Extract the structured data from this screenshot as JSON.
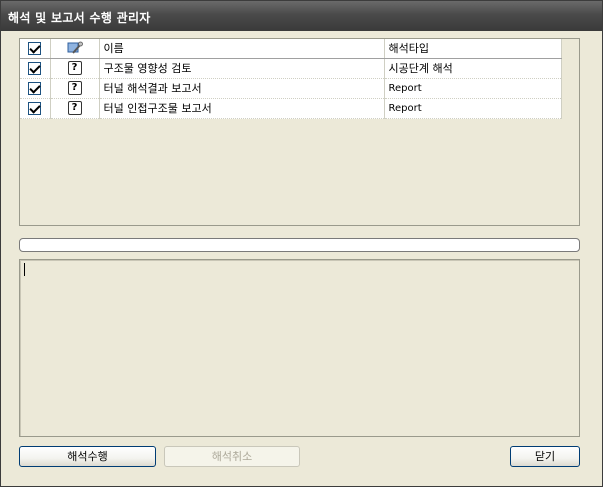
{
  "window": {
    "title": "해석 및 보고서 수행 관리자"
  },
  "grid": {
    "headers": {
      "name": "이름",
      "type": "해석타입"
    },
    "rows": [
      {
        "checked": true,
        "icon": "question-icon",
        "name": "구조물 영향성 검토",
        "type": "시공단계 해석"
      },
      {
        "checked": true,
        "icon": "question-icon",
        "name": "터널 해석결과 보고서",
        "type": "Report"
      },
      {
        "checked": true,
        "icon": "question-icon",
        "name": "터널 인접구조물 보고서",
        "type": "Report"
      }
    ],
    "icons": {
      "header_check": "checkbox-icon",
      "header_tool": "tools-icon",
      "row": "question-icon"
    },
    "question_glyph": "?"
  },
  "progress": {
    "value": 0
  },
  "log": {
    "text": ""
  },
  "buttons": {
    "run": "해석수행",
    "cancel": "해석취소",
    "close": "닫기"
  },
  "colors": {
    "title_bar": "#4a4a4a",
    "dialog_bg": "#ece9d8",
    "progress_fill": "#2ca12c"
  }
}
